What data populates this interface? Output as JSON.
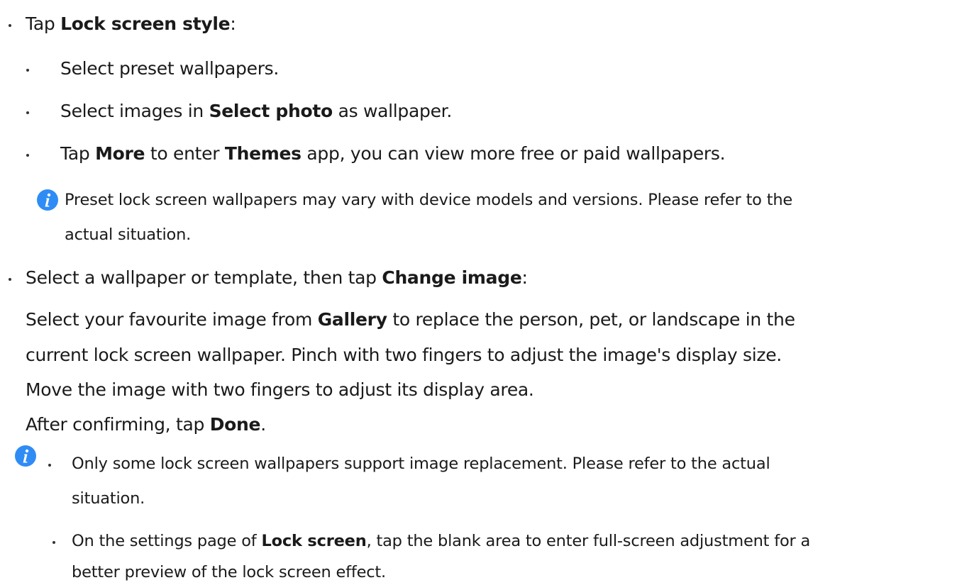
{
  "bullet_1": {
    "prefix": "Tap ",
    "bold": "Lock screen style",
    "suffix": ":"
  },
  "sub_items": [
    {
      "text": "Select preset wallpapers."
    },
    {
      "prefix": "Select images in ",
      "bold": "Select photo",
      "suffix": " as wallpaper."
    },
    {
      "prefix": "Tap ",
      "bold1": "More",
      "mid": " to enter ",
      "bold2": "Themes",
      "suffix": " app, you can view more free or paid wallpapers."
    }
  ],
  "note_1": {
    "icon": "info-icon",
    "line1": "Preset lock screen wallpapers may vary with device models and versions. Please refer to the",
    "line2": "actual situation."
  },
  "bullet_2": {
    "prefix": "Select a wallpaper or template, then tap ",
    "bold": "Change image",
    "suffix": ":",
    "para_line1_prefix": "Select your favourite image from ",
    "para_line1_bold": "Gallery",
    "para_line1_suffix": " to replace the person, pet, or landscape in the",
    "para_line2": "current lock screen wallpaper. Pinch with two fingers to adjust the image's display size.",
    "para_line3": "Move the image with two fingers to adjust its display area.",
    "para_line4_prefix": "After confirming, tap ",
    "para_line4_bold": "Done",
    "para_line4_suffix": "."
  },
  "note_2": {
    "icon": "info-icon",
    "item1_line1": "Only some lock screen wallpapers support image replacement. Please refer to the actual",
    "item1_line2": "situation.",
    "item2_line1_prefix": "On the settings page of ",
    "item2_line1_bold": "Lock screen",
    "item2_line1_suffix": ", tap the blank area to enter full-screen adjustment for a",
    "item2_line2": "better preview of the lock screen effect."
  },
  "colors": {
    "icon_blue": "#2f8cf5",
    "text": "#1a1a1a"
  }
}
